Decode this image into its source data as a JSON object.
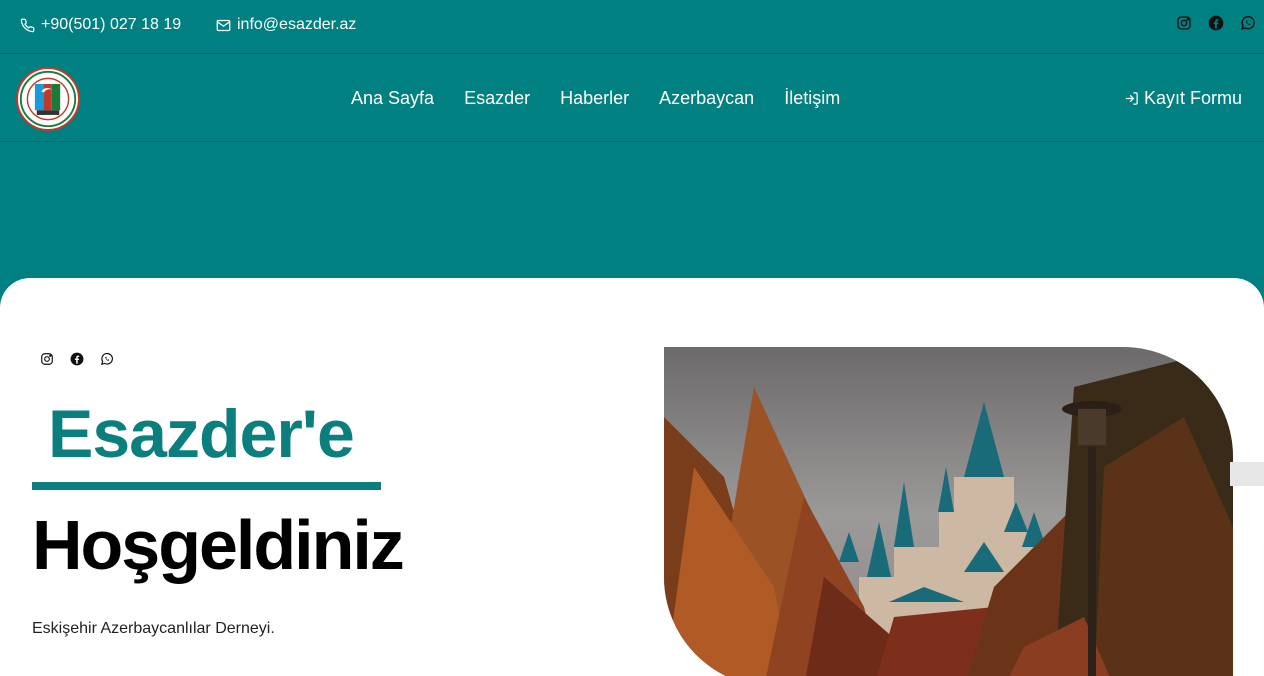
{
  "topbar": {
    "phone": "+90(501) 027 18 19",
    "email": "info@esazder.az",
    "social_icons": [
      "instagram-icon",
      "facebook-icon",
      "whatsapp-icon"
    ]
  },
  "nav": {
    "links": [
      "Ana Sayfa",
      "Esazder",
      "Haberler",
      "Azerbaycan",
      "İletişim"
    ],
    "register_label": "Kayıt Formu"
  },
  "hero": {
    "title": "Esazder'e",
    "subtitle": "Hoşgeldiniz",
    "description": "Eskişehir Azerbaycanlılar Derneyi.",
    "social_icons": [
      "instagram-icon",
      "facebook-icon",
      "whatsapp-icon"
    ]
  },
  "colors": {
    "primary": "#008080",
    "accent": "#0b7f7e",
    "text": "#000000"
  }
}
